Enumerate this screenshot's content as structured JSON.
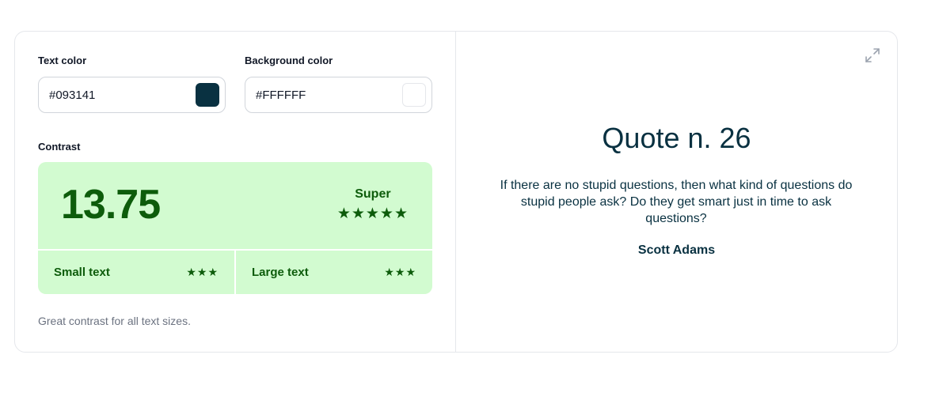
{
  "inputs": {
    "text_color": {
      "label": "Text color",
      "value": "#093141",
      "swatch": "#093141"
    },
    "background_color": {
      "label": "Background color",
      "value": "#FFFFFF",
      "swatch": "#FFFFFF"
    }
  },
  "contrast": {
    "label": "Contrast",
    "ratio": "13.75",
    "rating": "Super",
    "rating_stars": "★★★★★",
    "small_text": {
      "label": "Small text",
      "stars": "★★★"
    },
    "large_text": {
      "label": "Large text",
      "stars": "★★★"
    },
    "hint": "Great contrast for all text sizes.",
    "box_color": "#d2fbd0",
    "accent_color": "#0d5c0b"
  },
  "preview": {
    "expand_icon": "expand-icon",
    "title": "Quote n. 26",
    "quote": "If there are no stupid questions, then what kind of questions do stupid people ask? Do they get smart just in time to ask questions?",
    "author": "Scott Adams"
  }
}
